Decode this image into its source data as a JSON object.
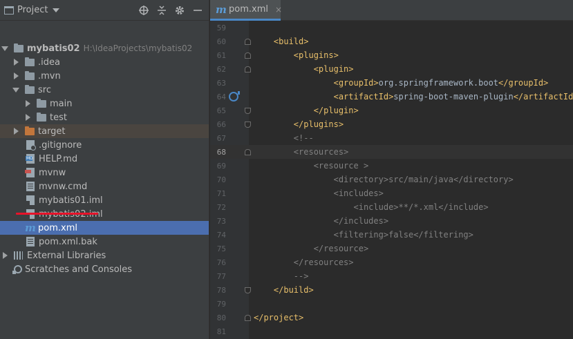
{
  "project_panel": {
    "title": "Project",
    "tree": [
      {
        "label": "mybatis02",
        "path": "H:\\IdeaProjects\\mybatis02",
        "icon": "module-folder-icon",
        "depth": 0,
        "expanded": true
      },
      {
        "label": ".idea",
        "icon": "folder-icon",
        "depth": 1,
        "expanded": false
      },
      {
        "label": ".mvn",
        "icon": "folder-icon",
        "depth": 1,
        "expanded": false
      },
      {
        "label": "src",
        "icon": "folder-icon",
        "depth": 1,
        "expanded": true
      },
      {
        "label": "main",
        "icon": "folder-icon",
        "depth": 2,
        "expanded": false
      },
      {
        "label": "test",
        "icon": "folder-icon",
        "depth": 2,
        "expanded": false
      },
      {
        "label": "target",
        "icon": "excluded-folder-icon",
        "depth": 1,
        "expanded": false
      },
      {
        "label": ".gitignore",
        "icon": "gitignore-file-icon",
        "depth": 1
      },
      {
        "label": "HELP.md",
        "icon": "markdown-file-icon",
        "depth": 1
      },
      {
        "label": "mvnw",
        "icon": "shell-script-icon",
        "depth": 1
      },
      {
        "label": "mvnw.cmd",
        "icon": "text-file-icon",
        "depth": 1
      },
      {
        "label": "mybatis01.iml",
        "icon": "iml-file-icon",
        "depth": 1
      },
      {
        "label": "mybatis02.iml",
        "icon": "iml-file-icon",
        "depth": 1
      },
      {
        "label": "pom.xml",
        "icon": "maven-file-icon",
        "depth": 1,
        "selected": true
      },
      {
        "label": "pom.xml.bak",
        "icon": "text-file-icon",
        "depth": 1
      },
      {
        "label": "External Libraries",
        "icon": "libraries-icon",
        "depth": 0,
        "expanded": false
      },
      {
        "label": "Scratches and Consoles",
        "icon": "scratches-icon",
        "depth": 0
      }
    ]
  },
  "editor": {
    "tab_label": "pom.xml",
    "tab_close": "×",
    "current_line": "68",
    "lines": [
      {
        "n": "59",
        "code": ""
      },
      {
        "n": "60",
        "code": "    <build>"
      },
      {
        "n": "61",
        "code": "        <plugins>"
      },
      {
        "n": "62",
        "code": "            <plugin>"
      },
      {
        "n": "63",
        "code": "                <groupId>org.springframework.boot</groupId>"
      },
      {
        "n": "64",
        "code": "                <artifactId>spring-boot-maven-plugin</artifactId>"
      },
      {
        "n": "65",
        "code": "            </plugin>"
      },
      {
        "n": "66",
        "code": "        </plugins>"
      },
      {
        "n": "67",
        "code": "        <!--"
      },
      {
        "n": "68",
        "code": "        <resources>"
      },
      {
        "n": "69",
        "code": "            <resource >"
      },
      {
        "n": "70",
        "code": "                <directory>src/main/java</directory>"
      },
      {
        "n": "71",
        "code": "                <includes>"
      },
      {
        "n": "72",
        "code": "                    <include>**/*.xml</include>"
      },
      {
        "n": "73",
        "code": "                </includes>"
      },
      {
        "n": "74",
        "code": "                <filtering>false</filtering>"
      },
      {
        "n": "75",
        "code": "            </resource>"
      },
      {
        "n": "76",
        "code": "        </resources>"
      },
      {
        "n": "77",
        "code": "        -->"
      },
      {
        "n": "78",
        "code": "    </build>"
      },
      {
        "n": "79",
        "code": ""
      },
      {
        "n": "80",
        "code": "</project>"
      },
      {
        "n": "81",
        "code": ""
      }
    ]
  },
  "colors": {
    "selection": "#4b6eaf",
    "xml_tag": "#e8bf6a",
    "comment": "#629755",
    "annotation_underline": "#e8132a"
  }
}
